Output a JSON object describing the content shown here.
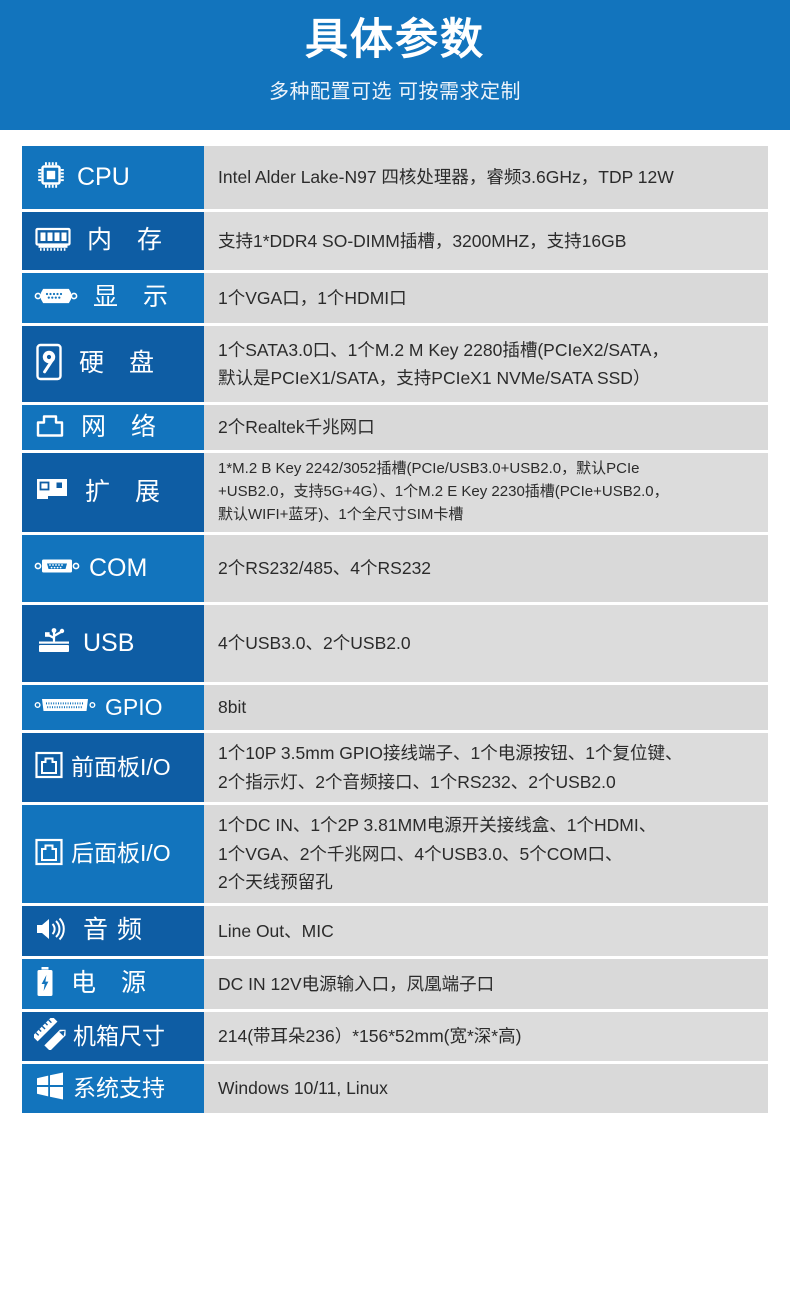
{
  "banner": {
    "title": "具体参数",
    "subtitle": "多种配置可选 可按需求定制",
    "bg_color": "#1274bd"
  },
  "colors": {
    "blue_light": "#1274bd",
    "blue_dark": "#0e5da4",
    "value_gray": "#d9d9d9",
    "text_dark": "#2b2b2b",
    "white": "#ffffff"
  },
  "rows": [
    {
      "icon": "cpu-chip-icon",
      "label": "CPU",
      "lines": [
        "Intel Alder Lake-N97 四核处理器，睿频3.6GHz，TDP 12W"
      ]
    },
    {
      "icon": "memory-module-icon",
      "label": "内 存",
      "lines": [
        "支持1*DDR4 SO-DIMM插槽，3200MHZ，支持16GB"
      ]
    },
    {
      "icon": "vga-connector-icon",
      "label": "显 示",
      "lines": [
        "1个VGA口，1个HDMI口"
      ]
    },
    {
      "icon": "hard-disk-icon",
      "label": "硬 盘",
      "lines": [
        "1个SATA3.0口、1个M.2 M Key 2280插槽(PCIeX2/SATA，",
        "默认是PCIeX1/SATA，支持PCIeX1 NVMe/SATA SSD）"
      ]
    },
    {
      "icon": "ethernet-port-icon",
      "label": "网 络",
      "lines": [
        "2个Realtek千兆网口"
      ]
    },
    {
      "icon": "expansion-card-icon",
      "label": "扩 展",
      "lines": [
        "1*M.2 B Key 2242/3052插槽(PCIe/USB3.0+USB2.0，默认PCIe",
        "+USB2.0，支持5G+4G）、1个M.2 E Key 2230插槽(PCIe+USB2.0，",
        "默认WIFI+蓝牙)、1个全尺寸SIM卡槽"
      ]
    },
    {
      "icon": "db9-serial-port-icon",
      "label": "COM",
      "lines": [
        "2个RS232/485、4个RS232"
      ]
    },
    {
      "icon": "usb-port-icon",
      "label": "USB",
      "lines": [
        "4个USB3.0、2个USB2.0"
      ]
    },
    {
      "icon": "gpio-connector-icon",
      "label": "GPIO",
      "lines": [
        "8bit"
      ]
    },
    {
      "icon": "front-panel-icon",
      "label": "前面板I/O",
      "lines": [
        "1个10P 3.5mm GPIO接线端子、1个电源按钮、1个复位键、",
        "2个指示灯、2个音频接口、1个RS232、2个USB2.0"
      ]
    },
    {
      "icon": "rear-panel-icon",
      "label": "后面板I/O",
      "lines": [
        "1个DC IN、1个2P 3.81MM电源开关接线盒、1个HDMI、",
        "1个VGA、2个千兆网口、4个USB3.0、5个COM口、",
        "2个天线预留孔"
      ]
    },
    {
      "icon": "speaker-icon",
      "label": "音频",
      "lines": [
        "Line Out、MIC"
      ]
    },
    {
      "icon": "battery-power-icon",
      "label": "电 源",
      "lines": [
        "DC IN 12V电源输入口，凤凰端子口"
      ]
    },
    {
      "icon": "ruler-pencil-icon",
      "label": "机箱尺寸",
      "lines": [
        "214(带耳朵236）*156*52mm(宽*深*高)"
      ]
    },
    {
      "icon": "windows-logo-icon",
      "label": "系统支持",
      "lines": [
        "Windows 10/11, Linux"
      ]
    }
  ]
}
